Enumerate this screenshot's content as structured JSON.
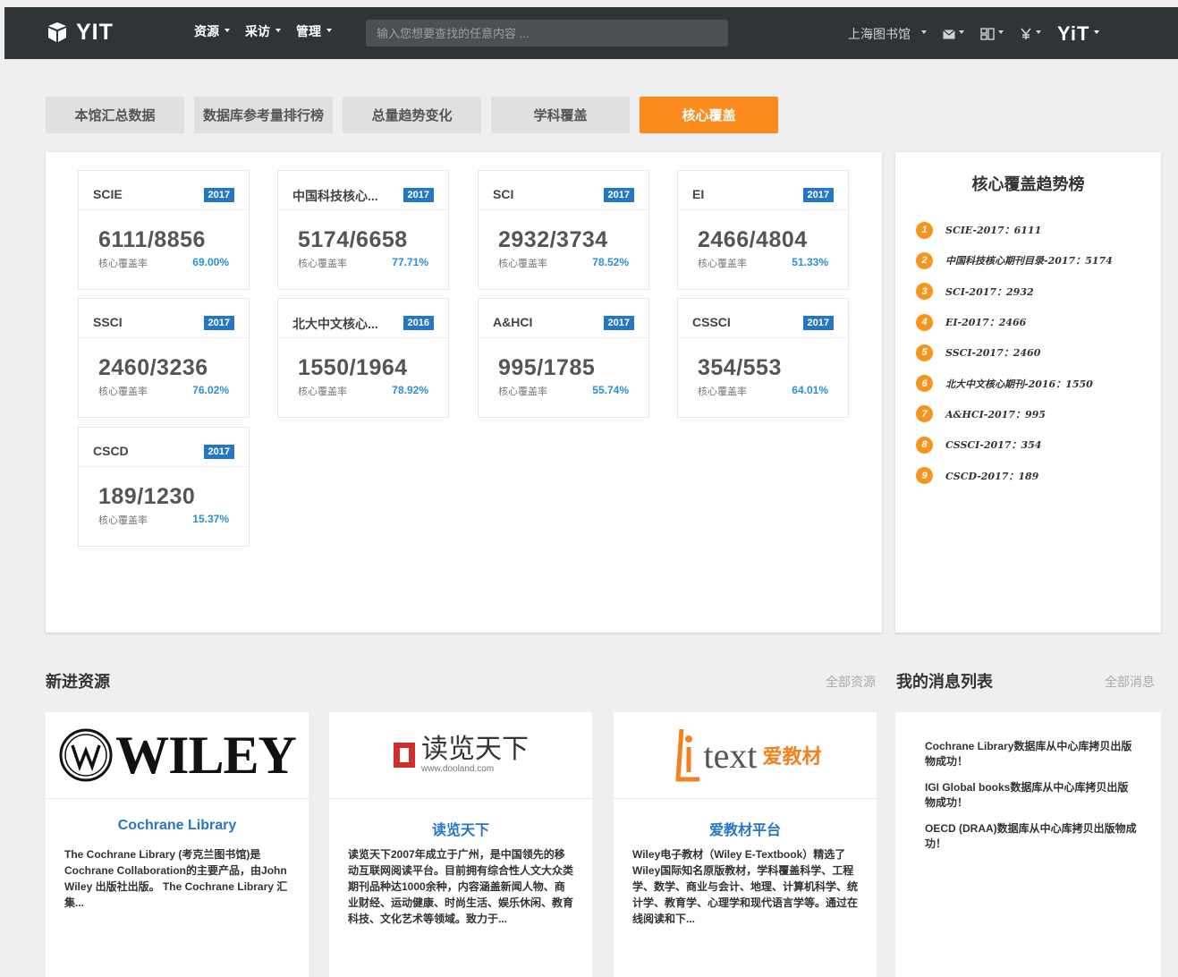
{
  "header": {
    "logo": "YIT",
    "menu": [
      {
        "label": "资源"
      },
      {
        "label": "采访"
      },
      {
        "label": "管理"
      }
    ],
    "search_placeholder": "输入您想要查找的任意内容 ...",
    "library": "上海图书馆",
    "brand_right": "YiT"
  },
  "tabs": [
    "本馆汇总数据",
    "数据库参考量排行榜",
    "总量趋势变化",
    "学科覆盖",
    "核心覆盖"
  ],
  "active_tab": "核心覆盖",
  "cards": [
    {
      "name": "SCIE",
      "year": "2017",
      "value": "6111/8856",
      "label": "核心覆盖率",
      "pct": "69.00%"
    },
    {
      "name": "中国科技核心...",
      "year": "2017",
      "value": "5174/6658",
      "label": "核心覆盖率",
      "pct": "77.71%"
    },
    {
      "name": "SCI",
      "year": "2017",
      "value": "2932/3734",
      "label": "核心覆盖率",
      "pct": "78.52%"
    },
    {
      "name": "EI",
      "year": "2017",
      "value": "2466/4804",
      "label": "核心覆盖率",
      "pct": "51.33%"
    },
    {
      "name": "SSCI",
      "year": "2017",
      "value": "2460/3236",
      "label": "核心覆盖率",
      "pct": "76.02%"
    },
    {
      "name": "北大中文核心...",
      "year": "2016",
      "value": "1550/1964",
      "label": "核心覆盖率",
      "pct": "78.92%"
    },
    {
      "name": "A&HCI",
      "year": "2017",
      "value": "995/1785",
      "label": "核心覆盖率",
      "pct": "55.74%"
    },
    {
      "name": "CSSCI",
      "year": "2017",
      "value": "354/553",
      "label": "核心覆盖率",
      "pct": "64.01%"
    },
    {
      "name": "CSCD",
      "year": "2017",
      "value": "189/1230",
      "label": "核心覆盖率",
      "pct": "15.37%"
    }
  ],
  "ranking": {
    "title": "核心覆盖趋势榜",
    "items": [
      {
        "num": "1",
        "text": "SCIE-2017：6111"
      },
      {
        "num": "2",
        "text": "中国科技核心期刊目录-2017：5174"
      },
      {
        "num": "3",
        "text": "SCI-2017：2932"
      },
      {
        "num": "4",
        "text": "EI-2017：2466"
      },
      {
        "num": "5",
        "text": "SSCI-2017：2460"
      },
      {
        "num": "6",
        "text": "北大中文核心期刊-2016：1550"
      },
      {
        "num": "7",
        "text": "A&HCI-2017：995"
      },
      {
        "num": "8",
        "text": "CSSCI-2017：354"
      },
      {
        "num": "9",
        "text": "CSCD-2017：189"
      }
    ]
  },
  "new_resources": {
    "title": "新进资源",
    "more": "全部资源",
    "items": [
      {
        "logo_text": "WILEY",
        "name": "Cochrane Library",
        "desc": "The Cochrane Library (考克兰图书馆)是Cochrane Collaboration的主要产品，由John Wiley 出版社出版。 The Cochrane Library 汇集..."
      },
      {
        "logo_text": "读览天下",
        "logo_sub": "www.dooland.com",
        "name": "读览天下",
        "desc": "读览天下2007年成立于广州，是中国领先的移动互联网阅读平台。目前拥有综合性人文大众类期刊品种达1000余种，内容涵盖新闻人物、商业财经、运动健康、时尚生活、娱乐休闲、教育科技、文化艺术等领域。致力于..."
      },
      {
        "logo_text": "text",
        "logo_cn": "爱教材",
        "name": "爱教材平台",
        "desc": "Wiley电子教材（Wiley E-Textbook）精选了Wiley国际知名原版教材，学科覆盖科学、工程学、数学、商业与会计、地理、计算机科学、统计学、教育学、心理学和现代语言学等。通过在线阅读和下..."
      }
    ]
  },
  "messages": {
    "title": "我的消息列表",
    "more": "全部消息",
    "items": [
      "Cochrane Library数据库从中心库拷贝出版物成功！",
      "IGI Global books数据库从中心库拷贝出版物成功！",
      "OECD (DRAA)数据库从中心库拷贝出版物成功！"
    ]
  },
  "colors": {
    "accent": "#fb8b1d",
    "topbar": "#2f3437",
    "badge": "#2477c2",
    "link": "#2677c5"
  }
}
